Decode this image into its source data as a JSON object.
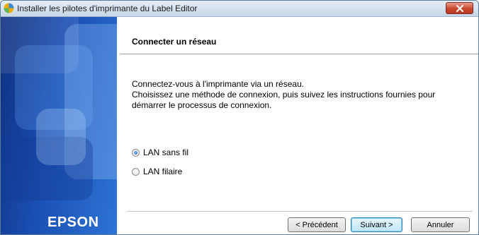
{
  "window": {
    "title": "Installer les pilotes d'imprimante du Label Editor"
  },
  "side_panel": {
    "logo_text": "EPSON"
  },
  "page": {
    "heading": "Connecter un réseau",
    "description": [
      "Connectez-vous à l'imprimante via un réseau.",
      "Choisissez une méthode de connexion, puis suivez les instructions fournies pour",
      "démarrer le processus de connexion."
    ]
  },
  "options": [
    {
      "label": "LAN sans fil",
      "checked": true
    },
    {
      "label": "LAN filaire",
      "checked": false
    }
  ],
  "buttons": {
    "back": "< Précédent",
    "next": "Suivant >",
    "cancel": "Annuler"
  },
  "colors": {
    "accent": "#1a4fb3",
    "close": "#c8482e"
  },
  "icons": {
    "app": "installer-app-icon",
    "close": "close-icon"
  }
}
